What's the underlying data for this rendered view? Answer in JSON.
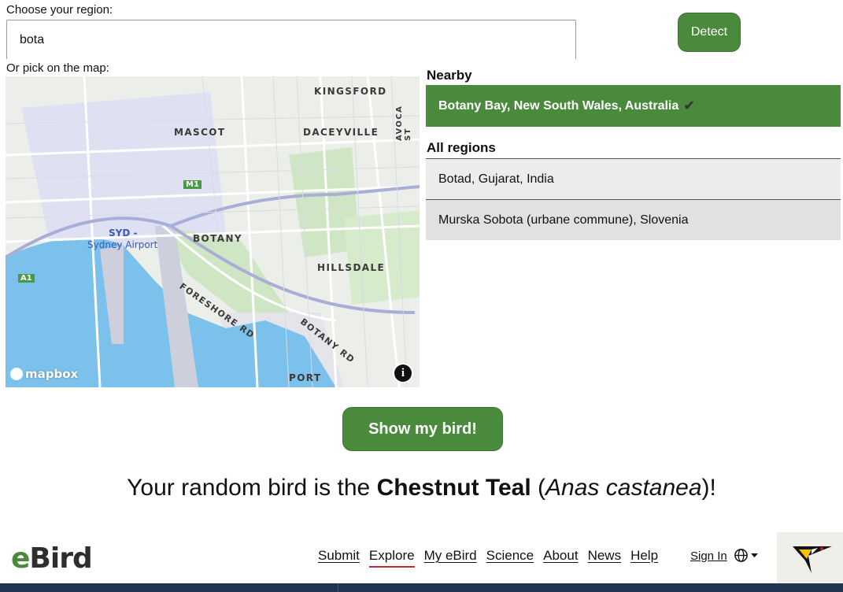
{
  "form": {
    "region_label": "Choose your region:",
    "search_value": "bota",
    "detect_label": "Detect",
    "map_label": "Or pick on the map:"
  },
  "map": {
    "place_labels": [
      "KINGSFORD",
      "MASCOT",
      "DACEYVILLE",
      "BOTANY",
      "HILLSDALE",
      "PORT",
      "SYD -",
      "Sydney Airport",
      "FORESHORE RD",
      "BOTANY RD",
      "AVOCA ST",
      "M1",
      "A1"
    ],
    "attribution": "mapbox",
    "info_icon": "info-icon"
  },
  "regions": {
    "nearby_heading": "Nearby",
    "nearby_item": "Botany Bay, New South Wales, Australia",
    "nearby_check": "✔",
    "all_heading": "All regions",
    "items": [
      "Botad, Gujarat, India",
      "Murska Sobota (urbane commune), Slovenia"
    ]
  },
  "show_label": "Show my bird!",
  "result": {
    "prefix": "Your random bird is the",
    "common_name": "Chestnut Teal",
    "scientific_name": "Anas castanea",
    "open": "(",
    "close": ")!"
  },
  "footer": {
    "logo_e": "e",
    "logo_bird": "Bird",
    "nav": [
      "Submit",
      "Explore",
      "My eBird",
      "Science",
      "About",
      "News",
      "Help"
    ],
    "active_nav": "Explore",
    "sign_in": "Sign In",
    "language_icon": "globe-icon"
  },
  "colors": {
    "accent_green": "#4a8a3c",
    "footer_bar": "#1f3552",
    "active_underline": "#c52a2a"
  }
}
